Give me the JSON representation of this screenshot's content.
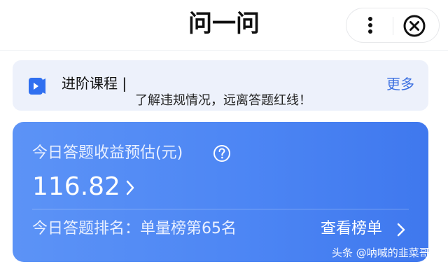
{
  "header": {
    "title": "问一问",
    "more_icon": "more-vertical-icon",
    "close_icon": "close-circle-icon"
  },
  "banner": {
    "title": "进阶课程 |",
    "subtitle": "了解违规情况，远离答题红线！",
    "more_label": "更多",
    "icon": "course-video-icon",
    "accent_color": "#3b6fe0"
  },
  "earnings": {
    "label": "今日答题收益预估(元)",
    "help_icon": "help-circle-icon",
    "value": "116.82",
    "rank_text": "今日答题排名：单量榜第65名",
    "rank_link_label": "查看榜单",
    "card_color": "#4d86f4"
  },
  "watermark": {
    "text": "头条 @呐喊的韭菜哥"
  }
}
